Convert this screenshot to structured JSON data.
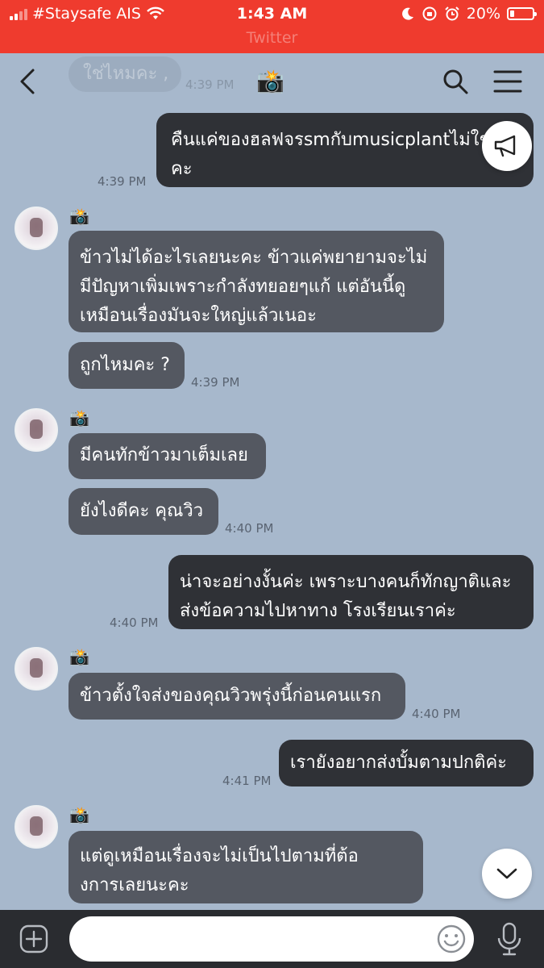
{
  "status": {
    "carrier": "#Staysafe AIS",
    "time": "1:43 AM",
    "battery": "20%",
    "subtitle": "Twitter"
  },
  "header": {
    "title_icon": "📸",
    "ghost_message": "ใช่ไหมคะ ,",
    "ghost_time": "4:39 PM"
  },
  "messages": [
    {
      "side": "mine",
      "lines": [
        "คืนแค่ของฮลฟจรsmกับmusicplantไม่ใช่",
        "คะ"
      ],
      "time": "4:39 PM"
    },
    {
      "side": "theirs",
      "sender": "📸",
      "lines": [
        "ข้าวไม่ได้อะไรเลยนะคะ ข้าวแค่พยายามจะไม่",
        "มีปัญหาเพิ่มเพราะกำลังทยอยๆแก้ แต่อันนี้ดู",
        "เหมือนเรื่องมันจะใหญ่แล้วเนอะ"
      ]
    },
    {
      "side": "theirs",
      "lines": [
        "ถูกไหมคะ ?"
      ],
      "time": "4:39 PM"
    },
    {
      "side": "theirs",
      "sender": "📸",
      "lines": [
        "มีคนทักข้าวมาเต็มเลย"
      ]
    },
    {
      "side": "theirs",
      "lines": [
        "ยังไงดีคะ คุณวิว"
      ],
      "time": "4:40 PM"
    },
    {
      "side": "mine",
      "lines": [
        "น่าจะอย่างงั้นค่ะ เพราะบางคนก็ทักญาติและ",
        "ส่งข้อความไปหาทาง โรงเรียนเราค่ะ"
      ],
      "time": "4:40 PM"
    },
    {
      "side": "theirs",
      "sender": "📸",
      "lines": [
        "ข้าวตั้งใจส่งของคุณวิวพรุ่งนี้ก่อนคนแรก"
      ],
      "time": "4:40 PM"
    },
    {
      "side": "mine",
      "lines": [
        "เรายังอยากส่งบั้มตามปกติค่ะ"
      ],
      "time": "4:41 PM"
    },
    {
      "side": "theirs",
      "sender": "📸",
      "lines": [
        "แต่ดูเหมือนเรื่องจะไม่เป็นไปตามที่ต้อ",
        "งการเลยนะคะ"
      ]
    }
  ],
  "input": {
    "placeholder": ""
  },
  "icons": {
    "back": "chevron-left-icon",
    "search": "search-icon",
    "menu": "hamburger-menu-icon",
    "announce": "megaphone-icon",
    "scroll_down": "chevron-down-icon",
    "plus": "plus-icon",
    "emoji": "smiley-icon",
    "mic": "microphone-icon"
  },
  "colors": {
    "status_bar": "#ef3b2e",
    "chat_bg": "#a7b8cc",
    "my_bubble": "#2f3136",
    "their_bubble": "#545861",
    "bottom_bar": "#2a2c30"
  }
}
